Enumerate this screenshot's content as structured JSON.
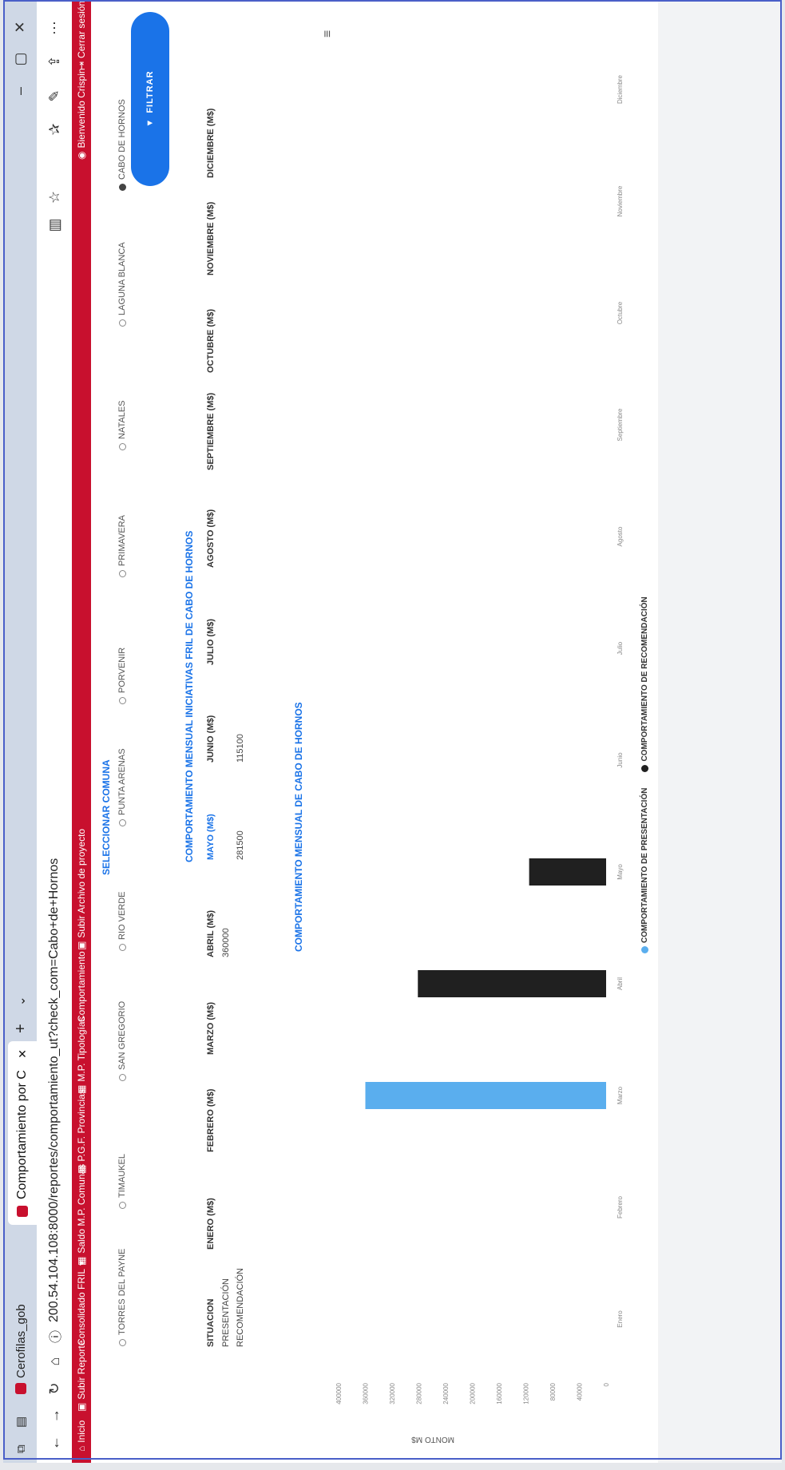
{
  "browser": {
    "tabs": [
      "Cerofilas_gob",
      "Comportamiento por C"
    ],
    "url": "200.54.104.108:8000/reportes/comportamiento_ut?check_com=Cabo+de+Hornos",
    "window_controls": [
      "–",
      "▢",
      "✕"
    ]
  },
  "site_nav": {
    "items": [
      "Inicio",
      "Subir Reporte",
      "Consolidado FRIL",
      "Saldo M.P. Comunas",
      "P.G.F. Provincias",
      "M.P. Tipologías",
      "Comportamiento",
      "Subir Archivo de proyecto"
    ],
    "user": "Bienvenido Crispin",
    "logout": "Cerrar sesión"
  },
  "filter": {
    "title": "SELECCIONAR COMUNA",
    "communes": [
      "TORRES DEL PAYNE",
      "TIMAUKEL",
      "SAN GREGORIO",
      "RIO VERDE",
      "PUNTA ARENAS",
      "PORVENIR",
      "PRIMAVERA",
      "NATALES",
      "LAGUNA BLANCA",
      "CABO DE HORNOS"
    ],
    "selected": "CABO DE HORNOS",
    "button": "FILTRAR"
  },
  "table": {
    "title": "COMPORTAMIENTO MENSUAL INICIATIVAS FRIL DE CABO DE HORNOS",
    "headers": [
      "SITUACION",
      "ENERO (M$)",
      "FEBRERO (M$)",
      "MARZO (M$)",
      "ABRIL (M$)",
      "MAYO (M$)",
      "JUNIO (M$)",
      "JULIO (M$)",
      "AGOSTO (M$)",
      "SEPTIEMBRE (M$)",
      "OCTUBRE (M$)",
      "NOVIEMBRE (M$)",
      "DICIEMBRE (M$)"
    ],
    "rows": [
      {
        "label": "PRESENTACIÓN",
        "cells": [
          "",
          "",
          "",
          "360000",
          "",
          "",
          "",
          "",
          "",
          "",
          "",
          ""
        ]
      },
      {
        "label": "RECOMENDACIÓN",
        "cells": [
          "",
          "",
          "",
          "",
          "281500",
          "115100",
          "",
          "",
          "",
          "",
          "",
          ""
        ]
      }
    ]
  },
  "chart_data": {
    "type": "bar",
    "title": "COMPORTAMIENTO MENSUAL DE CABO DE HORNOS",
    "ylabel": "MONTO M$",
    "categories": [
      "Enero",
      "Febrero",
      "Marzo",
      "Abril",
      "Mayo",
      "Junio",
      "Julio",
      "Agosto",
      "Septiembre",
      "Octubre",
      "Noviembre",
      "Diciembre"
    ],
    "series": [
      {
        "name": "COMPORTAMIENTO DE PRESENTACIÓN",
        "color": "#5aaeee",
        "values": [
          0,
          0,
          360000,
          0,
          0,
          0,
          0,
          0,
          0,
          0,
          0,
          0
        ]
      },
      {
        "name": "COMPORTAMIENTO DE RECOMENDACIÓN",
        "color": "#202020",
        "values": [
          0,
          0,
          0,
          281500,
          115100,
          0,
          0,
          0,
          0,
          0,
          0,
          0
        ]
      }
    ],
    "ylim": [
      0,
      400000
    ],
    "yticks": [
      0,
      40000,
      80000,
      120000,
      160000,
      200000,
      240000,
      280000,
      320000,
      360000,
      400000
    ],
    "grid": false,
    "legend": "bottom"
  }
}
